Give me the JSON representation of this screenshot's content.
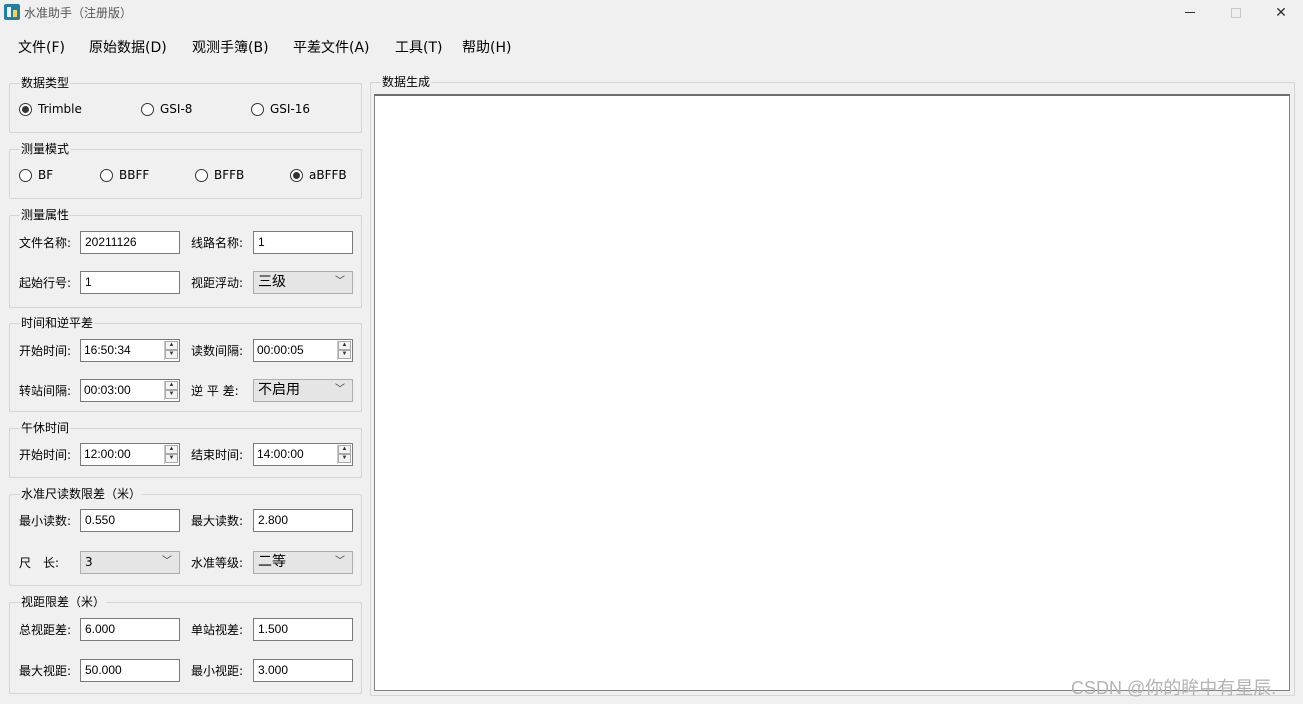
{
  "window": {
    "title": "水准助手（注册版）",
    "icon": "app-icon",
    "controls": [
      "minimize-icon",
      "maximize-icon",
      "close-icon"
    ]
  },
  "menu": [
    "文件(F)",
    "原始数据(D)",
    "观测手簿(B)",
    "平差文件(A)",
    "工具(T)",
    "帮助(H)"
  ],
  "data_type": {
    "title": "数据类型",
    "options": [
      "Trimble",
      "GSI-8",
      "GSI-16"
    ],
    "selected": "Trimble"
  },
  "measure_mode": {
    "title": "测量模式",
    "options": [
      "BF",
      "BBFF",
      "BFFB",
      "aBFFB"
    ],
    "selected": "aBFFB"
  },
  "measure_props": {
    "title": "测量属性",
    "file_name_label": "文件名称:",
    "file_name": "20211126",
    "route_name_label": "线路名称:",
    "route_name": "1",
    "start_row_label": "起始行号:",
    "start_row": "1",
    "sight_float_label": "视距浮动:",
    "sight_float": "三级"
  },
  "time_group": {
    "title": "时间和逆平差",
    "start_time_label": "开始时间:",
    "start_time": "16:50:34",
    "read_interval_label": "读数间隔:",
    "read_interval": "00:00:05",
    "station_interval_label": "转站间隔:",
    "station_interval": "00:03:00",
    "inverse_label": "逆 平 差:",
    "inverse": "不启用"
  },
  "lunch": {
    "title": "午休时间",
    "start_label": "开始时间:",
    "start": "12:00:00",
    "end_label": "结束时间:",
    "end": "14:00:00"
  },
  "rod_limit": {
    "title": "水准尺读数限差（米）",
    "min_label": "最小读数:",
    "min": "0.550",
    "max_label": "最大读数:",
    "max": "2.800",
    "length_label": "尺　长:",
    "length": "3",
    "grade_label": "水准等级:",
    "grade": "二等"
  },
  "sight_limit": {
    "title": "视距限差（米）",
    "total_label": "总视距差:",
    "total": "6.000",
    "single_label": "单站视差:",
    "single": "1.500",
    "max_label": "最大视距:",
    "max": "50.000",
    "min_label": "最小视距:",
    "min": "3.000"
  },
  "output": {
    "title": "数据生成",
    "content": ""
  },
  "watermark": "CSDN @你的眸中有星辰."
}
